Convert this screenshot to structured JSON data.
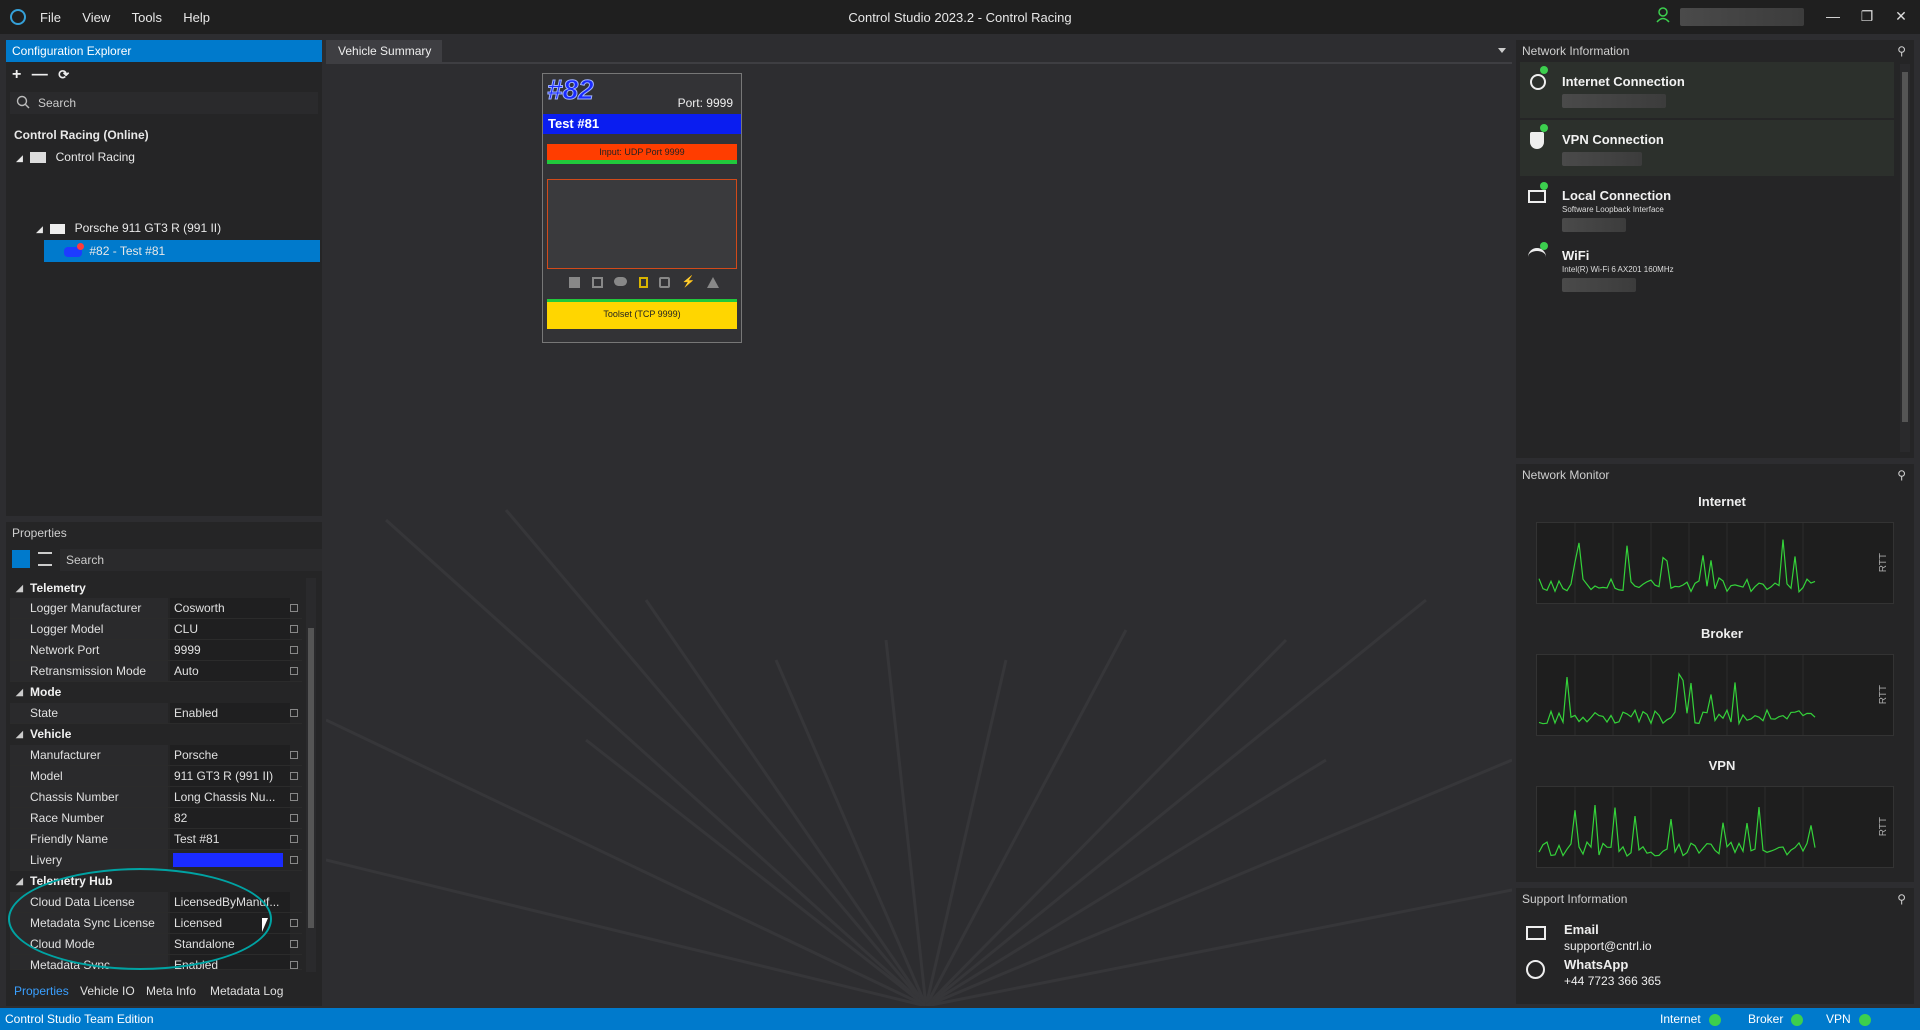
{
  "window": {
    "title": "Control Studio 2023.2 - Control Racing",
    "menu": [
      "File",
      "View",
      "Tools",
      "Help"
    ]
  },
  "explorer": {
    "title": "Configuration Explorer",
    "search_placeholder": "Search",
    "root_label": "Control Racing (Online)",
    "org_label": "Control Racing",
    "folder_label": "Porsche 911 GT3 R (991 II)",
    "vehicle_label": "#82 - Test #81"
  },
  "properties": {
    "title": "Properties",
    "search_placeholder": "Search",
    "categories": {
      "telemetry": "Telemetry",
      "mode": "Mode",
      "vehicle": "Vehicle",
      "hub": "Telemetry Hub"
    },
    "rows": [
      {
        "key": "Logger Manufacturer",
        "value": "Cosworth"
      },
      {
        "key": "Logger Model",
        "value": "CLU"
      },
      {
        "key": "Network Port",
        "value": "9999"
      },
      {
        "key": "Retransmission Mode",
        "value": "Auto"
      },
      {
        "key": "State",
        "value": "Enabled"
      },
      {
        "key": "Manufacturer",
        "value": "Porsche"
      },
      {
        "key": "Model",
        "value": "911 GT3 R (991 II)"
      },
      {
        "key": "Chassis Number",
        "value": "Long  Chassis  Nu..."
      },
      {
        "key": "Race Number",
        "value": "82"
      },
      {
        "key": "Friendly Name",
        "value": "Test #81"
      },
      {
        "key": "Livery",
        "value": ""
      },
      {
        "key": "Cloud Data License",
        "value": "LicensedByManuf..."
      },
      {
        "key": "Metadata Sync License",
        "value": "Licensed"
      },
      {
        "key": "Cloud Mode",
        "value": "Standalone"
      },
      {
        "key": "Metadata Sync",
        "value": "Enabled"
      }
    ],
    "bottom_tabs": [
      "Properties",
      "Vehicle IO",
      "Meta Info",
      "Metadata Log"
    ]
  },
  "summary": {
    "tab": "Vehicle Summary",
    "card": {
      "number": "#82",
      "port": "Port: 9999",
      "name": "Test #81",
      "input_label": "Input: UDP Port 9999",
      "toolset_label": "Toolset (TCP 9999)"
    }
  },
  "network_info": {
    "title": "Network Information",
    "items": [
      {
        "title": "Internet Connection",
        "sub": ""
      },
      {
        "title": "VPN Connection",
        "sub": ""
      },
      {
        "title": "Local Connection",
        "sub": "Software Loopback Interface"
      },
      {
        "title": "WiFi",
        "sub": "Intel(R) Wi-Fi 6 AX201 160MHz"
      }
    ]
  },
  "network_monitor": {
    "title": "Network Monitor",
    "charts": [
      {
        "name": "Internet",
        "axis": "RTT"
      },
      {
        "name": "Broker",
        "axis": "RTT"
      },
      {
        "name": "VPN",
        "axis": "RTT"
      }
    ]
  },
  "support": {
    "title": "Support Information",
    "email_label": "Email",
    "email": "support@cntrl.io",
    "whatsapp_label": "WhatsApp",
    "whatsapp": "+44 7723 366 365"
  },
  "statusbar": {
    "edition": "Control Studio Team Edition",
    "internet": "Internet",
    "broker": "Broker",
    "vpn": "VPN"
  },
  "colors": {
    "accent": "#007acc",
    "card_name_bar": "#0a1df0",
    "input_bar": "#ff3d00",
    "toolset_bar": "#ffd600",
    "status_ok": "#3ccf4e",
    "chart_line": "#34d23a",
    "annotation": "#00a3a3"
  }
}
